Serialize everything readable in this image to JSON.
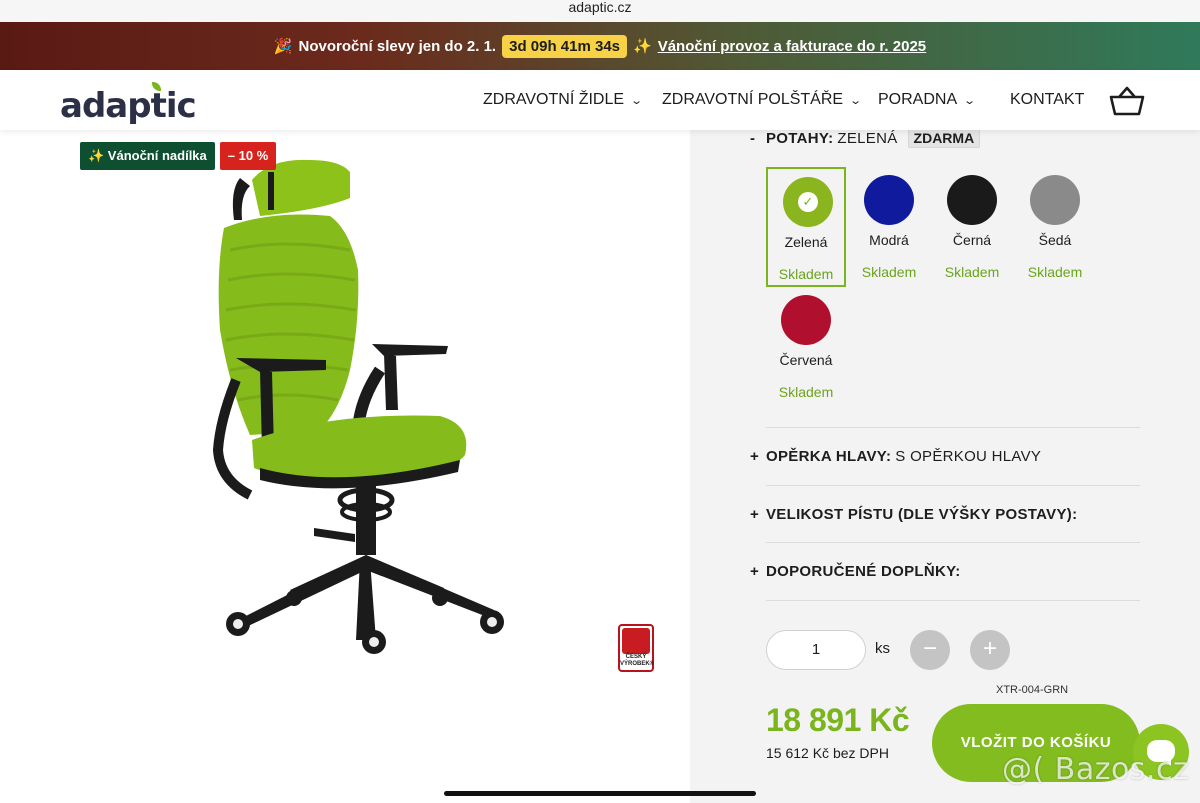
{
  "browser": {
    "url": "adaptic.cz"
  },
  "promo": {
    "emoji_left": "🎉",
    "text": "Novoroční slevy jen do 2. 1.",
    "timer": "3d 09h 41m 34s",
    "emoji_right": "✨",
    "link": "Vánoční provoz a fakturace do r. 2025"
  },
  "header": {
    "logo": "adaptic",
    "nav": [
      {
        "label": "ZDRAVOTNÍ ŽIDLE",
        "dropdown": true
      },
      {
        "label": "ZDRAVOTNÍ POLŠTÁŘE",
        "dropdown": true
      },
      {
        "label": "PORADNA",
        "dropdown": true
      },
      {
        "label": "KONTAKT",
        "dropdown": false
      }
    ],
    "basket_icon": "basket-icon"
  },
  "product": {
    "badges": [
      "✨ Vánoční nadílka",
      "– 10 %"
    ],
    "cz_badge": "ČESKÝ VÝROBEK®"
  },
  "config": {
    "potahy": {
      "sign": "-",
      "label": "POTAHY:",
      "value": "ZELENÁ",
      "extra": "ZDARMA"
    },
    "swatches": [
      {
        "name": "Zelená",
        "stock": "Skladem",
        "color": "#8bb51e",
        "selected": true
      },
      {
        "name": "Modrá",
        "stock": "Skladem",
        "color": "#101a9c",
        "selected": false
      },
      {
        "name": "Černá",
        "stock": "Skladem",
        "color": "#1a1a1a",
        "selected": false
      },
      {
        "name": "Šedá",
        "stock": "Skladem",
        "color": "#8a8a8a",
        "selected": false
      },
      {
        "name": "Červená",
        "stock": "Skladem",
        "color": "#b0102e",
        "selected": false
      }
    ],
    "options": [
      {
        "sign": "+",
        "label": "OPĚRKA HLAVY:",
        "value": "S OPĚRKOU HLAVY"
      },
      {
        "sign": "+",
        "label": "VELIKOST PÍSTU (DLE VÝŠKY POSTAVY):",
        "value": ""
      },
      {
        "sign": "+",
        "label": "DOPORUČENÉ DOPLŇKY:",
        "value": ""
      }
    ]
  },
  "purchase": {
    "quantity": "1",
    "unit": "ks",
    "minus": "−",
    "plus": "+",
    "sku": "XTR-004-GRN",
    "price": "18 891 Kč",
    "price_net": "15 612 Kč bez DPH",
    "cart_button": "VLOŽIT DO KOŠÍKU"
  },
  "watermark": "@( Bazos.cz",
  "colors": {
    "accent": "#7ab51d",
    "dark_green": "#0e4e31",
    "sale_red": "#d7231d"
  }
}
